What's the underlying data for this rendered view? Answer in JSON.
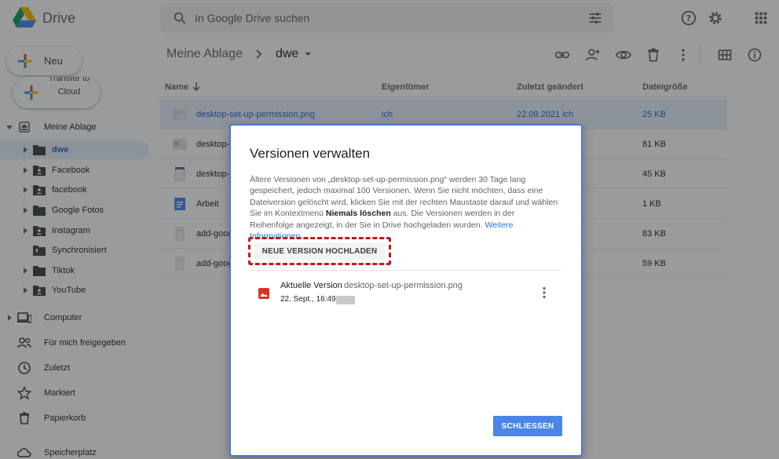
{
  "app": {
    "name": "Drive"
  },
  "search": {
    "placeholder": "In Google Drive suchen"
  },
  "sidebar": {
    "new_label": "Neu",
    "transfer_label": "Transfer to Cloud",
    "my_drive": "Meine Ablage",
    "folders": [
      {
        "label": "dwe",
        "active": true
      },
      {
        "label": "Facebook"
      },
      {
        "label": "facebook"
      },
      {
        "label": "Google Fotos"
      },
      {
        "label": "Instagram"
      },
      {
        "label": "Synchronisiert"
      },
      {
        "label": "Tiktok"
      },
      {
        "label": "YouTube"
      }
    ],
    "nav": [
      {
        "label": "Computer"
      },
      {
        "label": "Für mich freigegeben"
      },
      {
        "label": "Zuletzt"
      },
      {
        "label": "Markiert"
      },
      {
        "label": "Papierkorb"
      },
      {
        "label": "Speicherplatz"
      }
    ]
  },
  "breadcrumb": {
    "root": "Meine Ablage",
    "current": "dwe"
  },
  "list": {
    "headers": {
      "name": "Name",
      "owner": "Eigentümer",
      "modified": "Zuletzt geändert",
      "size": "Dateigröße"
    },
    "rows": [
      {
        "name": "desktop-set-up-permission.png",
        "owner": "ich",
        "modified": "22.09.2021 ich",
        "size": "25 KB"
      },
      {
        "name": "desktop-",
        "owner": "",
        "modified": "",
        "size": "81 KB"
      },
      {
        "name": "desktop-",
        "owner": "",
        "modified": "",
        "size": "45 KB"
      },
      {
        "name": "Arbeit",
        "owner": "",
        "modified": "",
        "size": "1 KB"
      },
      {
        "name": "add-goog",
        "owner": "",
        "modified": "",
        "size": "83 KB"
      },
      {
        "name": "add-goog",
        "owner": "",
        "modified": "",
        "size": "59 KB"
      }
    ]
  },
  "dialog": {
    "title": "Versionen verwalten",
    "text_part1": "Ältere Versionen von „desktop-set-up-permission.png“ werden 30 Tage lang gespeichert, jedoch maximal 100 Versionen. Wenn Sie nicht möchten, dass eine Dateiversion gelöscht wird, klicken Sie mit der rechten Maustaste darauf und wählen Sie im Kontextmenü ",
    "text_bold": "Niemals löschen",
    "text_part2": " aus. Die Versionen werden in der Reihenfolge angezeigt, in der Sie in Drive hochgeladen wurden. ",
    "text_link": "Weitere Informationen",
    "upload_label": "NEUE VERSION HOCHLADEN",
    "version": {
      "label": "Aktuelle Version",
      "file": "desktop-set-up-permission.png",
      "date": "22. Sept., 16:49"
    },
    "close_label": "SCHLIESSEN"
  },
  "colors": {
    "accent": "#1a73e8",
    "highlight": "#c5161d",
    "selected_row": "#e8f0fe",
    "close_button": "#4a86e8"
  }
}
